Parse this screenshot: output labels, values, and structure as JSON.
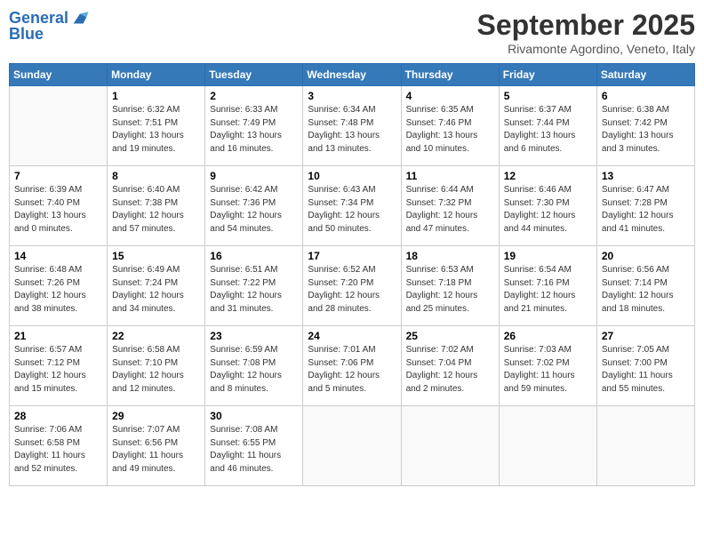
{
  "header": {
    "logo_line1": "General",
    "logo_line2": "Blue",
    "month": "September 2025",
    "location": "Rivamonte Agordino, Veneto, Italy"
  },
  "days_of_week": [
    "Sunday",
    "Monday",
    "Tuesday",
    "Wednesday",
    "Thursday",
    "Friday",
    "Saturday"
  ],
  "weeks": [
    [
      {
        "day": null
      },
      {
        "day": "1",
        "sunrise": "6:32 AM",
        "sunset": "7:51 PM",
        "daylight": "13 hours and 19 minutes."
      },
      {
        "day": "2",
        "sunrise": "6:33 AM",
        "sunset": "7:49 PM",
        "daylight": "13 hours and 16 minutes."
      },
      {
        "day": "3",
        "sunrise": "6:34 AM",
        "sunset": "7:48 PM",
        "daylight": "13 hours and 13 minutes."
      },
      {
        "day": "4",
        "sunrise": "6:35 AM",
        "sunset": "7:46 PM",
        "daylight": "13 hours and 10 minutes."
      },
      {
        "day": "5",
        "sunrise": "6:37 AM",
        "sunset": "7:44 PM",
        "daylight": "13 hours and 6 minutes."
      },
      {
        "day": "6",
        "sunrise": "6:38 AM",
        "sunset": "7:42 PM",
        "daylight": "13 hours and 3 minutes."
      }
    ],
    [
      {
        "day": "7",
        "sunrise": "6:39 AM",
        "sunset": "7:40 PM",
        "daylight": "13 hours and 0 minutes."
      },
      {
        "day": "8",
        "sunrise": "6:40 AM",
        "sunset": "7:38 PM",
        "daylight": "12 hours and 57 minutes."
      },
      {
        "day": "9",
        "sunrise": "6:42 AM",
        "sunset": "7:36 PM",
        "daylight": "12 hours and 54 minutes."
      },
      {
        "day": "10",
        "sunrise": "6:43 AM",
        "sunset": "7:34 PM",
        "daylight": "12 hours and 50 minutes."
      },
      {
        "day": "11",
        "sunrise": "6:44 AM",
        "sunset": "7:32 PM",
        "daylight": "12 hours and 47 minutes."
      },
      {
        "day": "12",
        "sunrise": "6:46 AM",
        "sunset": "7:30 PM",
        "daylight": "12 hours and 44 minutes."
      },
      {
        "day": "13",
        "sunrise": "6:47 AM",
        "sunset": "7:28 PM",
        "daylight": "12 hours and 41 minutes."
      }
    ],
    [
      {
        "day": "14",
        "sunrise": "6:48 AM",
        "sunset": "7:26 PM",
        "daylight": "12 hours and 38 minutes."
      },
      {
        "day": "15",
        "sunrise": "6:49 AM",
        "sunset": "7:24 PM",
        "daylight": "12 hours and 34 minutes."
      },
      {
        "day": "16",
        "sunrise": "6:51 AM",
        "sunset": "7:22 PM",
        "daylight": "12 hours and 31 minutes."
      },
      {
        "day": "17",
        "sunrise": "6:52 AM",
        "sunset": "7:20 PM",
        "daylight": "12 hours and 28 minutes."
      },
      {
        "day": "18",
        "sunrise": "6:53 AM",
        "sunset": "7:18 PM",
        "daylight": "12 hours and 25 minutes."
      },
      {
        "day": "19",
        "sunrise": "6:54 AM",
        "sunset": "7:16 PM",
        "daylight": "12 hours and 21 minutes."
      },
      {
        "day": "20",
        "sunrise": "6:56 AM",
        "sunset": "7:14 PM",
        "daylight": "12 hours and 18 minutes."
      }
    ],
    [
      {
        "day": "21",
        "sunrise": "6:57 AM",
        "sunset": "7:12 PM",
        "daylight": "12 hours and 15 minutes."
      },
      {
        "day": "22",
        "sunrise": "6:58 AM",
        "sunset": "7:10 PM",
        "daylight": "12 hours and 12 minutes."
      },
      {
        "day": "23",
        "sunrise": "6:59 AM",
        "sunset": "7:08 PM",
        "daylight": "12 hours and 8 minutes."
      },
      {
        "day": "24",
        "sunrise": "7:01 AM",
        "sunset": "7:06 PM",
        "daylight": "12 hours and 5 minutes."
      },
      {
        "day": "25",
        "sunrise": "7:02 AM",
        "sunset": "7:04 PM",
        "daylight": "12 hours and 2 minutes."
      },
      {
        "day": "26",
        "sunrise": "7:03 AM",
        "sunset": "7:02 PM",
        "daylight": "11 hours and 59 minutes."
      },
      {
        "day": "27",
        "sunrise": "7:05 AM",
        "sunset": "7:00 PM",
        "daylight": "11 hours and 55 minutes."
      }
    ],
    [
      {
        "day": "28",
        "sunrise": "7:06 AM",
        "sunset": "6:58 PM",
        "daylight": "11 hours and 52 minutes."
      },
      {
        "day": "29",
        "sunrise": "7:07 AM",
        "sunset": "6:56 PM",
        "daylight": "11 hours and 49 minutes."
      },
      {
        "day": "30",
        "sunrise": "7:08 AM",
        "sunset": "6:55 PM",
        "daylight": "11 hours and 46 minutes."
      },
      {
        "day": null
      },
      {
        "day": null
      },
      {
        "day": null
      },
      {
        "day": null
      }
    ]
  ]
}
